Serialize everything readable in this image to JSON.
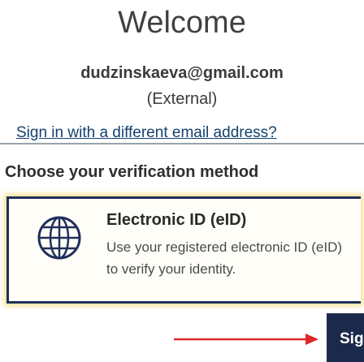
{
  "header": {
    "title": "Welcome"
  },
  "account": {
    "email": "dudzinskaeva@gmail.com",
    "type": "(External)",
    "switch_link": "Sign in with a different email address?"
  },
  "verification": {
    "section_title": "Choose your verification method",
    "methods": [
      {
        "icon": "globe-icon",
        "title": "Electronic ID (eID)",
        "description": "Use your registered electronic ID (eID) to verify your identity."
      }
    ]
  },
  "actions": {
    "next_label": "Sig"
  },
  "annotation": {
    "arrow_color": "#e0262b"
  },
  "colors": {
    "link": "#14406e",
    "card_border": "#1f2f5c",
    "card_highlight": "#f0c83c",
    "button_bg": "#1b2a4a"
  }
}
